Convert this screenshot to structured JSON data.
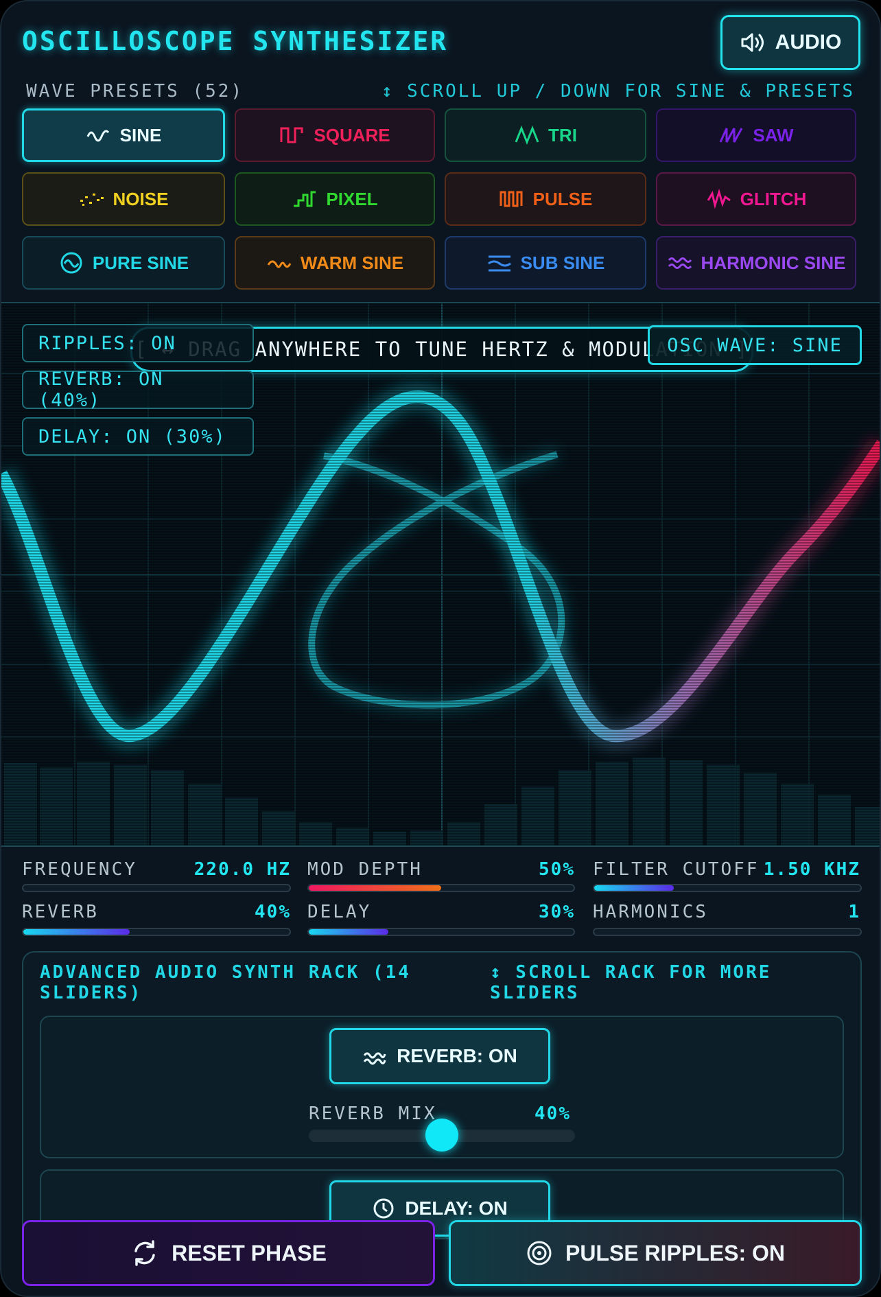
{
  "header": {
    "title": "OSCILLOSCOPE SYNTHESIZER",
    "audio_label": "AUDIO",
    "presets_label": "WAVE PRESETS (52)",
    "scroll_hint": "↕ SCROLL UP / DOWN FOR SINE & PRESETS"
  },
  "presets": [
    {
      "label": "SINE",
      "color": "#e8fbff",
      "active": true
    },
    {
      "label": "SQUARE",
      "color": "#f0205a"
    },
    {
      "label": "TRI",
      "color": "#18d68a"
    },
    {
      "label": "SAW",
      "color": "#7a22e8"
    },
    {
      "label": "NOISE",
      "color": "#f0d020"
    },
    {
      "label": "PIXEL",
      "color": "#30d830"
    },
    {
      "label": "PULSE",
      "color": "#f06018"
    },
    {
      "label": "GLITCH",
      "color": "#f01890"
    },
    {
      "label": "PURE SINE",
      "color": "#22d8e6"
    },
    {
      "label": "WARM SINE",
      "color": "#f08a18"
    },
    {
      "label": "SUB SINE",
      "color": "#3a8cf0"
    },
    {
      "label": "HARMONIC SINE",
      "color": "#9a48f0"
    }
  ],
  "scope": {
    "ripples": "RIPPLES: ON",
    "reverb": "REVERB: ON (40%)",
    "delay": "DELAY: ON (30%)",
    "drag_hint": "[ ↔ DRAG ANYWHERE TO TUNE HERTZ & MODULATION ]",
    "osc_wave": "OSC WAVE: SINE"
  },
  "params": [
    {
      "label": "FREQUENCY",
      "value": "220.0 HZ",
      "level": 0.0
    },
    {
      "label": "MOD DEPTH",
      "value": "50%",
      "level": 0.5
    },
    {
      "label": "FILTER CUTOFF",
      "value": "1.50 KHZ",
      "level": 0.3
    },
    {
      "label": "REVERB",
      "value": "40%",
      "level": 0.4
    },
    {
      "label": "DELAY",
      "value": "30%",
      "level": 0.3
    },
    {
      "label": "HARMONICS",
      "value": "1",
      "level": 0.0
    }
  ],
  "rack": {
    "title": "ADVANCED AUDIO SYNTH RACK (14 SLIDERS)",
    "hint": "↕ SCROLL RACK FOR MORE SLIDERS",
    "reverb_button": "REVERB: ON",
    "reverb_mix_label": "REVERB MIX",
    "reverb_mix_value": "40%",
    "reverb_mix_level": 0.4,
    "delay_button": "DELAY: ON"
  },
  "footer": {
    "reset_label": "RESET PHASE",
    "pulse_label": "PULSE RIPPLES: ON"
  },
  "colors": {
    "accent": "#22e5f0",
    "background": "#0b1520"
  }
}
